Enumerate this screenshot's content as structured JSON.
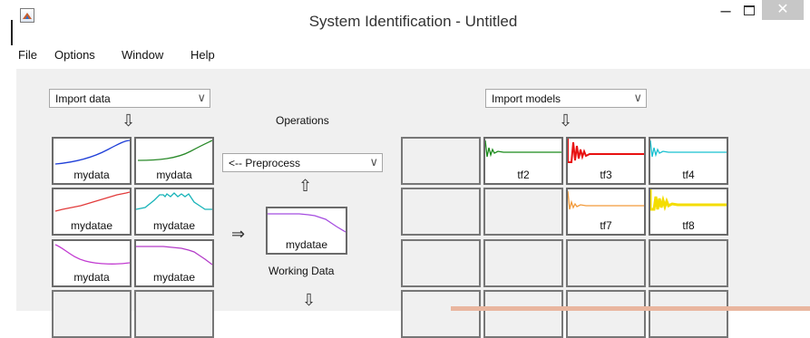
{
  "window": {
    "title": "System Identification - Untitled",
    "minimize_icon": "minimize-icon",
    "maximize_icon": "maximize-icon",
    "close_icon": "close-icon"
  },
  "menu": [
    "File",
    "Options",
    "Window",
    "Help"
  ],
  "import_data": {
    "selected": "Import data"
  },
  "import_models": {
    "selected": "Import models"
  },
  "operations": {
    "label": "Operations",
    "preprocess_selected": "<-- Preprocess"
  },
  "working_data": {
    "label": "Working Data",
    "tile_label": "mydatae"
  },
  "data_board": [
    {
      "label": "mydata",
      "color": "#1f3fd8"
    },
    {
      "label": "mydata",
      "color": "#2a8a2a"
    },
    {
      "label": "mydatae",
      "color": "#e23b3b"
    },
    {
      "label": "mydatae",
      "color": "#17b3b8"
    },
    {
      "label": "mydata",
      "color": "#c23bd1"
    },
    {
      "label": "mydatae",
      "color": "#b33bc8"
    }
  ],
  "model_board": [
    {
      "label": "tf2",
      "color": "#1a8a1a"
    },
    {
      "label": "tf3",
      "color": "#e81010"
    },
    {
      "label": "tf4",
      "color": "#18c0d0"
    },
    {
      "label": "tf7",
      "color": "#f29a3a"
    },
    {
      "label": "tf8",
      "color": "#f4dd00"
    }
  ],
  "colors": {
    "working_data_curve": "#a54de0",
    "background": "#f0f0f0",
    "tile_border": "#6a6a6a"
  }
}
